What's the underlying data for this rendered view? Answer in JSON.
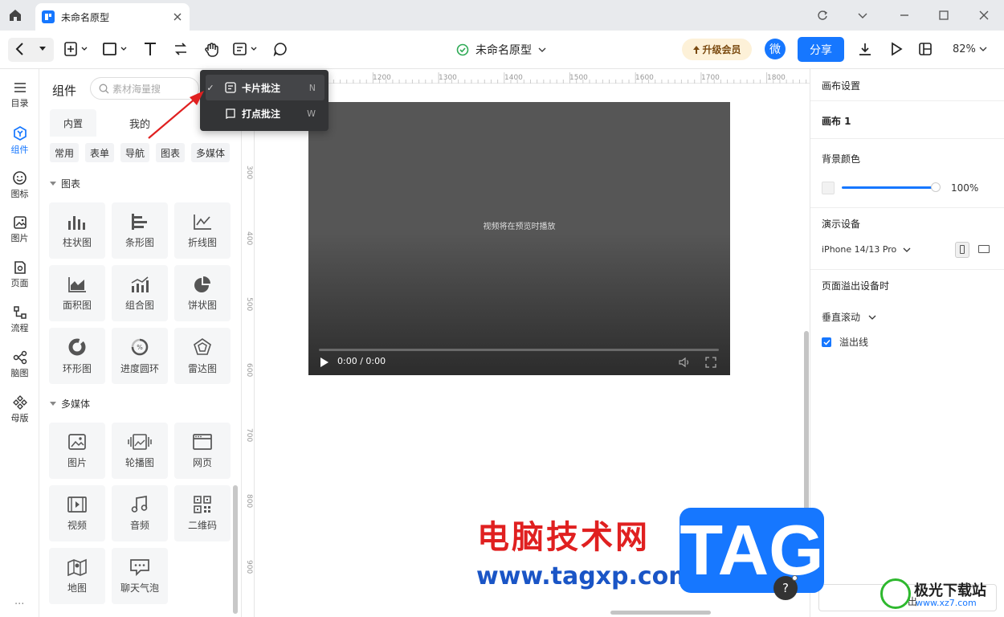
{
  "window": {
    "tab_title": "未命名原型"
  },
  "toolbar": {
    "doc_title": "未命名原型",
    "upgrade_label": "升级会员",
    "avatar_label": "微",
    "share_label": "分享",
    "zoom": "82%"
  },
  "leftnav": {
    "items": [
      {
        "label": "目录"
      },
      {
        "label": "组件"
      },
      {
        "label": "图标"
      },
      {
        "label": "图片"
      },
      {
        "label": "页面"
      },
      {
        "label": "流程"
      },
      {
        "label": "脑图"
      },
      {
        "label": "母版"
      }
    ],
    "more": "···"
  },
  "panel": {
    "title": "组件",
    "search_placeholder": "素材海量搜",
    "tabs": [
      "内置",
      "我的"
    ],
    "categories": [
      "常用",
      "表单",
      "导航",
      "图表",
      "多媒体"
    ],
    "sections": [
      {
        "title": "图表",
        "items": [
          "柱状图",
          "条形图",
          "折线图",
          "面积图",
          "组合图",
          "饼状图",
          "环形图",
          "进度圆环",
          "雷达图"
        ]
      },
      {
        "title": "多媒体",
        "items": [
          "图片",
          "轮播图",
          "网页",
          "视频",
          "音频",
          "二维码",
          "地图",
          "聊天气泡"
        ]
      }
    ]
  },
  "dropdown": {
    "items": [
      {
        "check": "✓",
        "label": "卡片批注",
        "key": "N"
      },
      {
        "check": "",
        "label": "打点批注",
        "key": "W"
      }
    ]
  },
  "ruler": {
    "top": [
      "1200",
      "1300",
      "1400",
      "1500",
      "1600",
      "1700",
      "1800"
    ],
    "left": [
      "300",
      "400",
      "500",
      "600",
      "700",
      "800",
      "900"
    ]
  },
  "video": {
    "message": "视频将在预览时播放",
    "time": "0:00 / 0:00"
  },
  "right": {
    "title": "画布设置",
    "canvas_name": "画布 1",
    "bg_label": "背景颜色",
    "bg_opacity": "100%",
    "device_label": "演示设备",
    "device_value": "iPhone 14/13 Pro",
    "overflow_label": "页面溢出设备时",
    "scroll_value": "垂直滚动",
    "overflow_line": "溢出线",
    "export_label": "导出"
  },
  "watermark": {
    "cn": "电脑技术网",
    "tag": "TAG",
    "url": "www.tagxp.com",
    "jg": "极光下载站",
    "jg_url": "www.xz7.com"
  },
  "colors": {
    "accent": "#1677ff",
    "watermark_red": "#e02020"
  }
}
